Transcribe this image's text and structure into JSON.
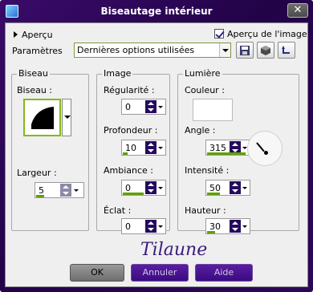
{
  "window": {
    "title": "Biseautage intérieur",
    "close_glyph": "✕"
  },
  "preview": {
    "label": "Aperçu"
  },
  "show_image": {
    "label": "Aperçu de l'image",
    "checked": true
  },
  "presets": {
    "label": "Paramètres",
    "selected": "Dernières options utilisées",
    "buttons": [
      "save-icon",
      "reset-icon",
      "undo-icon"
    ]
  },
  "biseau_group": {
    "title": "Biseau",
    "biseau_label": "Biseau :",
    "largeur_label": "Largeur :",
    "largeur_value": "5"
  },
  "image_group": {
    "title": "Image",
    "regularite_label": "Régularité :",
    "regularite_value": "0",
    "profondeur_label": "Profondeur :",
    "profondeur_value": "10",
    "ambiance_label": "Ambiance :",
    "ambiance_value": "0",
    "eclat_label": "Éclat :",
    "eclat_value": "0"
  },
  "lumiere_group": {
    "title": "Lumière",
    "couleur_label": "Couleur :",
    "couleur_value": "#ffffff",
    "angle_label": "Angle :",
    "angle_value": "315",
    "intensite_label": "Intensité :",
    "intensite_value": "50",
    "hauteur_label": "Hauteur :",
    "hauteur_value": "30"
  },
  "footer": {
    "ok_label": "OK",
    "cancel_label": "Annuler",
    "help_label": "Aide",
    "signature": "Tilaune"
  },
  "colors": {
    "frame": "#2a0552",
    "accent_green": "#5fa000",
    "spinner": "#240a5e"
  }
}
